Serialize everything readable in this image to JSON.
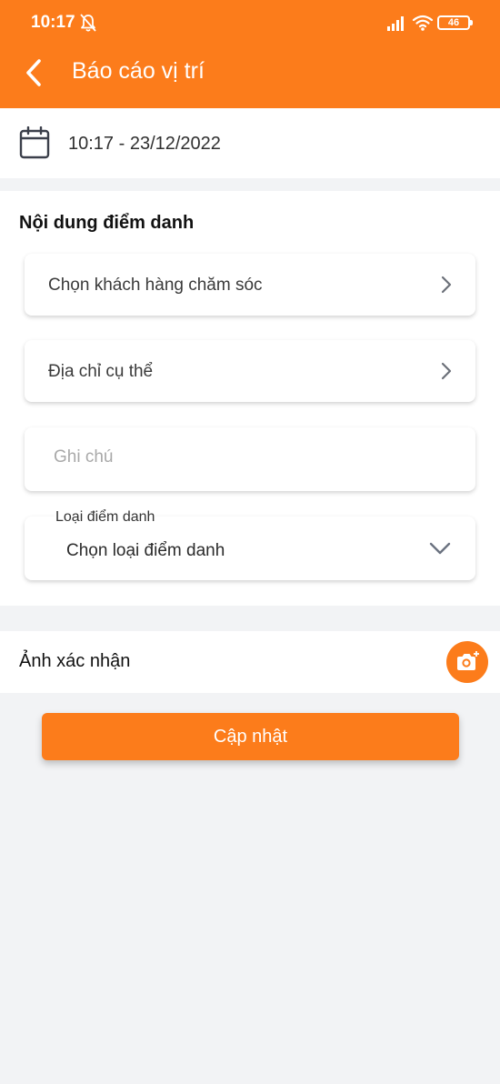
{
  "status_bar": {
    "time": "10:17",
    "battery": "46",
    "icons": [
      "bell-off-icon",
      "signal-icon",
      "wifi-icon",
      "battery-icon"
    ]
  },
  "header": {
    "title": "Báo cáo vị trí",
    "back_icon": "chevron-left-icon",
    "background_color": "#fc7c1b"
  },
  "date_row": {
    "icon": "calendar-icon",
    "value": "10:17 - 23/12/2022"
  },
  "form": {
    "section_title": "Nội dung điểm danh",
    "customer_select": {
      "label": "Chọn khách hàng chăm sóc",
      "icon": "chevron-right-icon"
    },
    "address_select": {
      "label": "Địa chỉ cụ thể",
      "icon": "chevron-right-icon"
    },
    "note_input": {
      "placeholder": "Ghi chú",
      "value": ""
    },
    "checkin_type": {
      "legend": "Loại điểm danh",
      "value": "Chọn loại điểm danh",
      "icon": "chevron-down-icon"
    }
  },
  "photo": {
    "label": "Ảnh xác nhận",
    "icon": "camera-add-icon"
  },
  "submit_button": {
    "label": "Cập nhật"
  },
  "colors": {
    "accent": "#fc7c1b",
    "page_background": "#f2f3f5"
  }
}
